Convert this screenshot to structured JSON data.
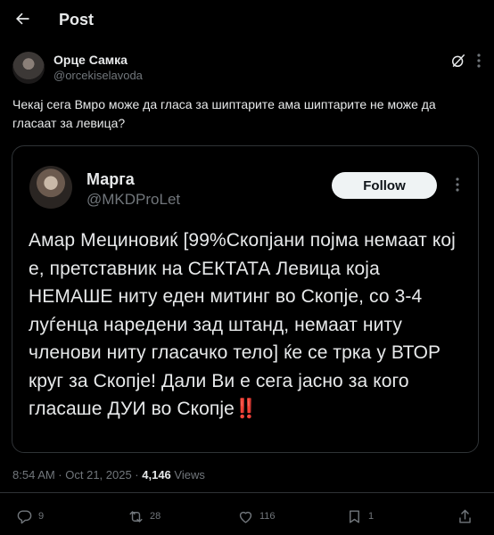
{
  "header": {
    "title": "Post",
    "back_icon": "arrow-left-icon"
  },
  "post": {
    "author_name": "Орце Самка",
    "author_handle": "@orcekiselavoda",
    "text": "Чекај сега Вмро може да гласа за шиптарите ама шиптарите не може да гласаат за левица?",
    "timestamp": "8:54 AM · Oct 21, 2025 · ",
    "views_count": "4,146",
    "views_label": " Views"
  },
  "quote": {
    "author_name": "Марга",
    "author_handle": "@MKDProLet",
    "follow_label": "Follow",
    "text": "Амар Мециновиќ [99%Скопјани појма немаат кој е, претставник на СЕКТАТА Левица која НЕМАШЕ ниту еден митинг во Скопје, со 3-4 луѓенца наредени зад штанд, немаат ниту членови ниту гласачко тело] ќе се трка у ВТОР круг за Скопје! Дали Ви е сега јасно за кого гласаше ДУИ во Скопје",
    "emoji": "‼️"
  },
  "actions": {
    "replies": "9",
    "reposts": "28",
    "likes": "116",
    "bookmarks": "1"
  },
  "colors": {
    "background": "#000000",
    "text": "#e7e9ea",
    "muted": "#71767b",
    "border": "#2f3336",
    "follow_bg": "#eff3f4"
  }
}
